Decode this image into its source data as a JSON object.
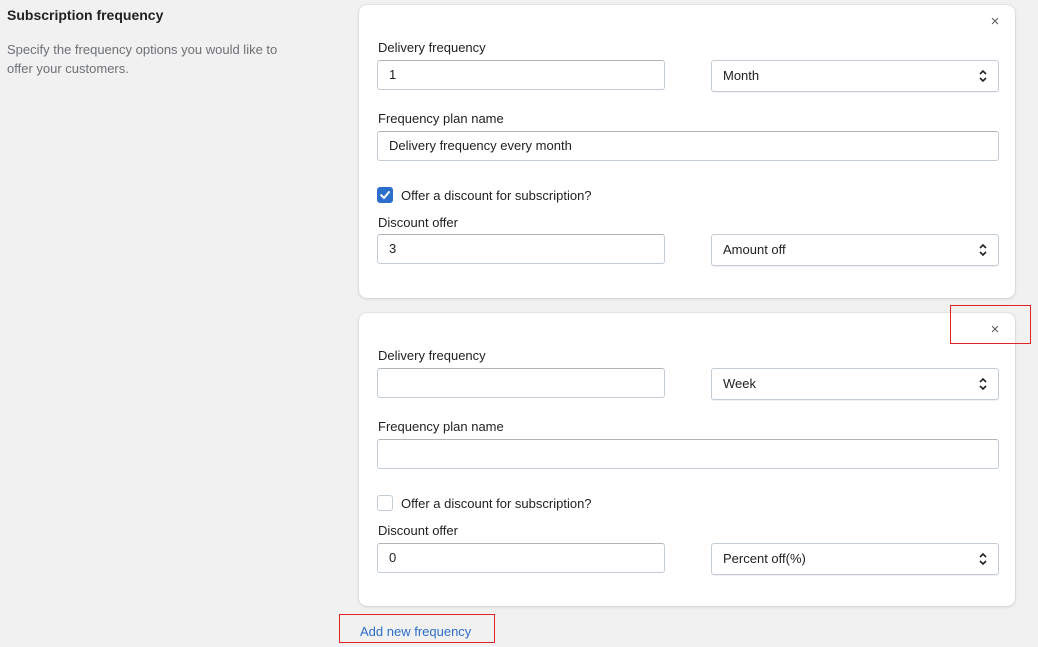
{
  "section": {
    "title": "Subscription frequency",
    "description": "Specify the frequency options you would like to offer your customers."
  },
  "plans": [
    {
      "delivery_frequency_label": "Delivery frequency",
      "delivery_frequency_value": "1",
      "interval_selected": "Month",
      "plan_name_label": "Frequency plan name",
      "plan_name_value": "Delivery frequency every month",
      "discount_checkbox_label": "Offer a discount for subscription?",
      "discount_checked": true,
      "discount_offer_label": "Discount offer",
      "discount_offer_value": "3",
      "discount_type_selected": "Amount off",
      "close_icon": "×"
    },
    {
      "delivery_frequency_label": "Delivery frequency",
      "delivery_frequency_value": "",
      "interval_selected": "Week",
      "plan_name_label": "Frequency plan name",
      "plan_name_value": "",
      "discount_checkbox_label": "Offer a discount for subscription?",
      "discount_checked": false,
      "discount_offer_label": "Discount offer",
      "discount_offer_value": "0",
      "discount_type_selected": "Percent off(%)",
      "close_icon": "×"
    }
  ],
  "add_new_frequency_label": "Add new frequency",
  "colors": {
    "accent": "#2c6ecb",
    "highlight": "#e02424",
    "background": "#f1f1f1"
  }
}
